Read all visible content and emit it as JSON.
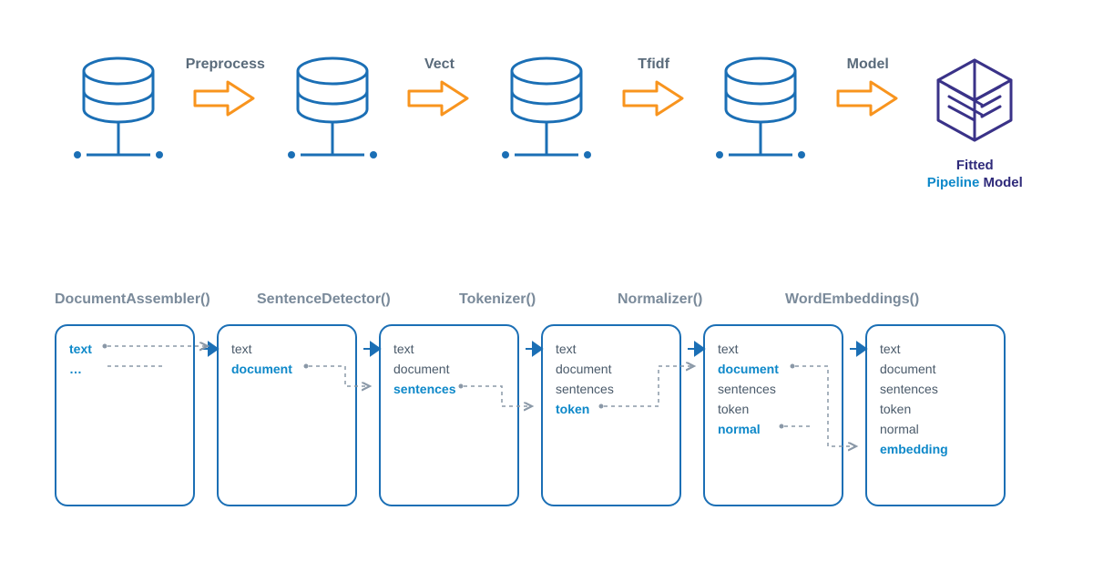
{
  "top": {
    "arrows": [
      "Preprocess",
      "Vect",
      "Tfidf",
      "Model"
    ],
    "model_label_1": "Fitted",
    "model_label_2": "Pipeline",
    "model_label_3": "Model"
  },
  "stages": {
    "labels": [
      "DocumentAssembler()",
      "SentenceDetector()",
      "Tokenizer()",
      "Normalizer()",
      "WordEmbeddings()"
    ]
  },
  "boxes": [
    {
      "lines": [
        {
          "t": "text",
          "hl": true
        },
        {
          "t": "…",
          "hl": true
        }
      ]
    },
    {
      "lines": [
        {
          "t": "text",
          "hl": false
        },
        {
          "t": "document",
          "hl": true
        }
      ]
    },
    {
      "lines": [
        {
          "t": "text",
          "hl": false
        },
        {
          "t": "document",
          "hl": false
        },
        {
          "t": "sentences",
          "hl": true
        }
      ]
    },
    {
      "lines": [
        {
          "t": "text",
          "hl": false
        },
        {
          "t": "document",
          "hl": false
        },
        {
          "t": "sentences",
          "hl": false
        },
        {
          "t": "token",
          "hl": true
        }
      ]
    },
    {
      "lines": [
        {
          "t": "text",
          "hl": false
        },
        {
          "t": "document",
          "hl": true
        },
        {
          "t": "sentences",
          "hl": false
        },
        {
          "t": "token",
          "hl": false
        },
        {
          "t": "normal",
          "hl": true
        }
      ]
    },
    {
      "lines": [
        {
          "t": "text",
          "hl": false
        },
        {
          "t": "document",
          "hl": false
        },
        {
          "t": "sentences",
          "hl": false
        },
        {
          "t": "token",
          "hl": false
        },
        {
          "t": "normal",
          "hl": false
        },
        {
          "t": "embedding",
          "hl": true
        }
      ]
    }
  ],
  "colors": {
    "blue": "#1b6fb5",
    "lightblue": "#0d88c9",
    "orange": "#f8941e",
    "purple": "#3a3288",
    "gray": "#7a8a9a"
  }
}
